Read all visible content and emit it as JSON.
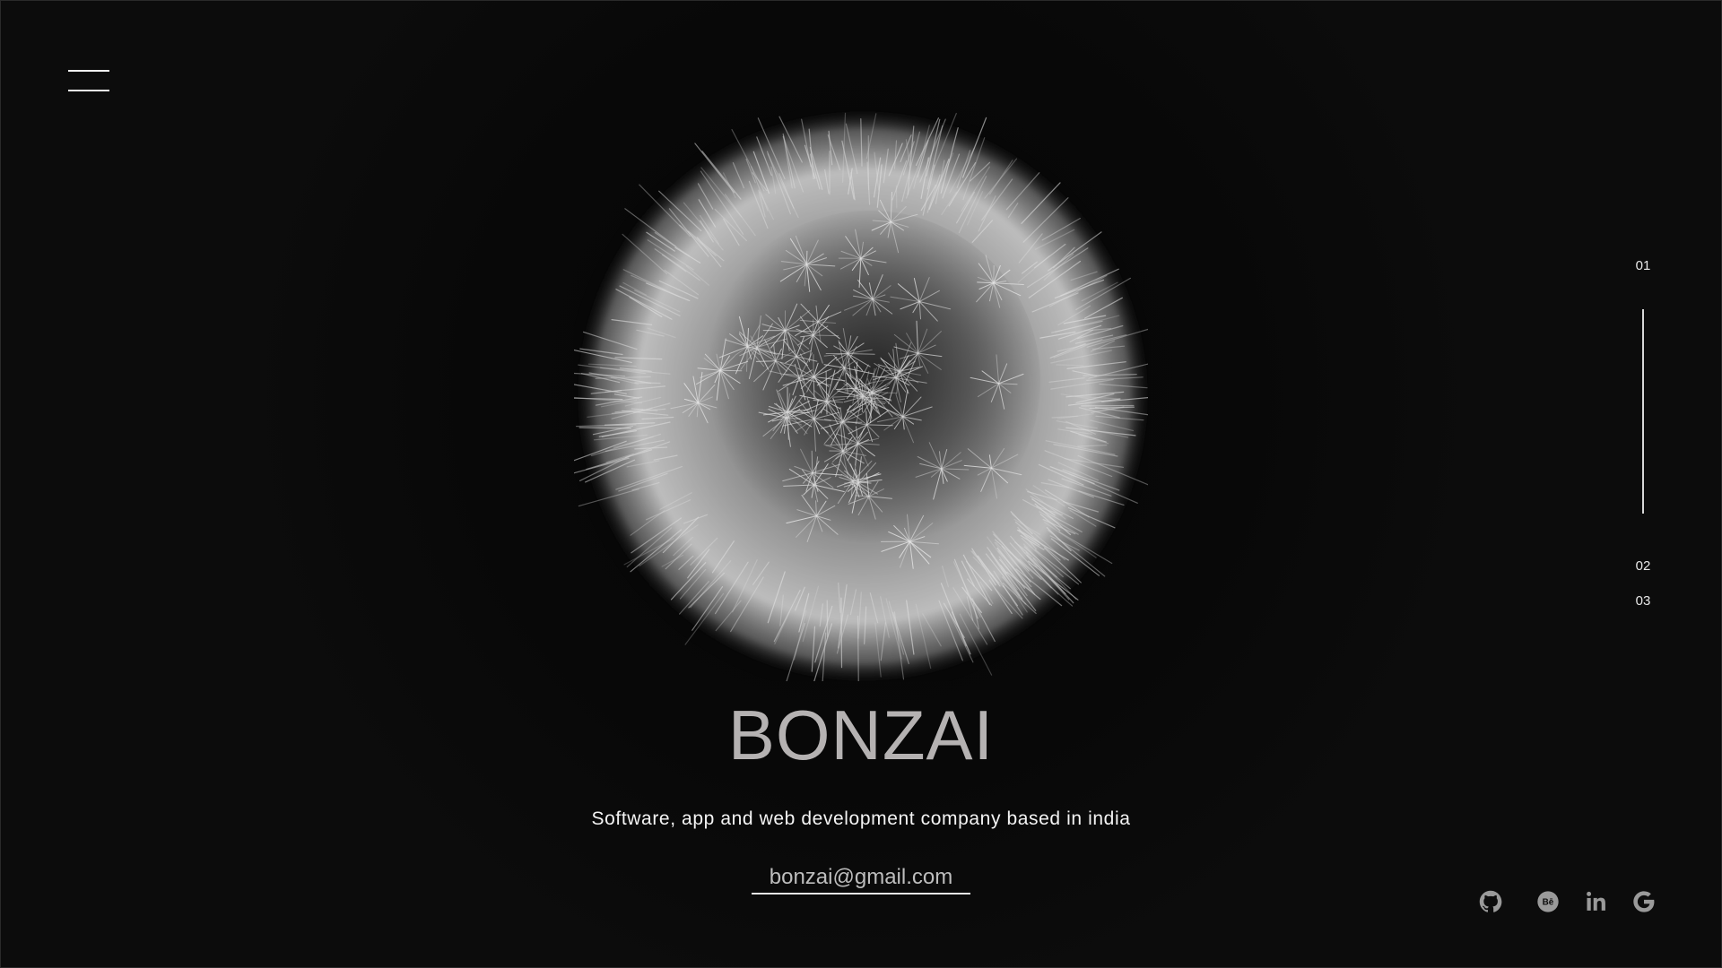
{
  "brand": {
    "name": "BONZAI",
    "tagline": "Software, app and web development company based in india",
    "email": "bonzai@gmail.com"
  },
  "pager": {
    "items": [
      "01",
      "02",
      "03"
    ],
    "active_index": 0
  },
  "social": [
    {
      "name": "github",
      "icon": "github-icon"
    },
    {
      "name": "behance",
      "icon": "behance-icon"
    },
    {
      "name": "linkedin",
      "icon": "linkedin-icon"
    },
    {
      "name": "google",
      "icon": "google-icon"
    }
  ],
  "colors": {
    "background": "#0c0c0c",
    "brand_text": "#b5b2b2",
    "accent_white": "#f4f4f4",
    "icon_gray": "#9a9a9a"
  }
}
